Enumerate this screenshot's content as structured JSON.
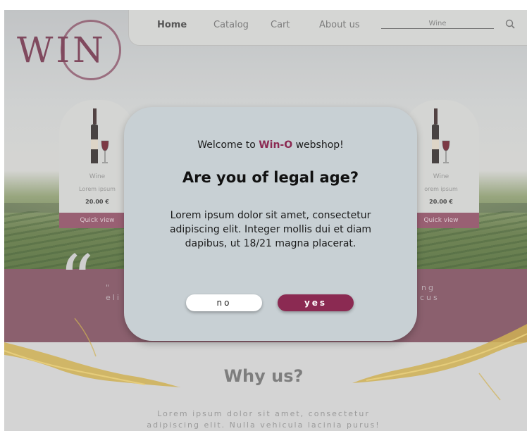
{
  "header": {
    "logo_text": "WIN",
    "nav": {
      "home": "Home",
      "catalog": "Catalog",
      "cart": "Cart",
      "about": "About us"
    },
    "search": {
      "placeholder": "Wine"
    }
  },
  "cards": [
    {
      "title": "Wine",
      "desc": "Lorem ipsum",
      "price": "20.00 €",
      "button": "Quick view"
    },
    {
      "title": "Wine",
      "desc": "orem ipsum",
      "price": "20.00 €",
      "button": "Quick view"
    }
  ],
  "testimonial": {
    "left_line1": "\"",
    "left_line2": "eli",
    "right_line1": "ng",
    "right_line2": "cus"
  },
  "why_us": {
    "title": "Why us?",
    "text_line1": "Lorem ipsum dolor sit amet, consectetur",
    "text_line2": "adipiscing elit. Nulla vehicula lacinia purus!"
  },
  "modal": {
    "welcome_prefix": "Welcome to ",
    "brand": "Win-O",
    "welcome_suffix": " webshop!",
    "title": "Are you of legal age?",
    "body": "Lorem ipsum dolor sit amet, consectetur adipiscing elit. Integer mollis dui et diam dapibus, ut 18/21 magna placerat.",
    "no_label": "no",
    "yes_label": "yes"
  },
  "colors": {
    "accent": "#8b2a52",
    "modal_bg": "#c8d0d4",
    "testimonial_bg": "#7b4a5a"
  }
}
